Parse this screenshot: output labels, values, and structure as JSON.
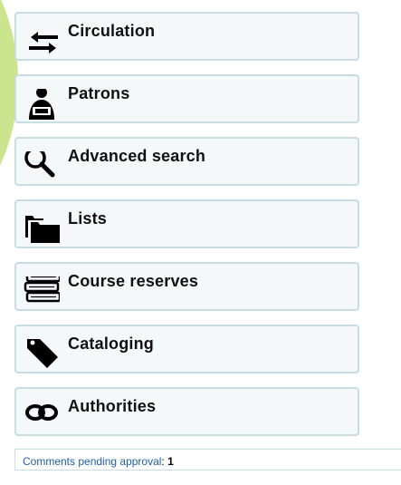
{
  "menu": {
    "items": [
      {
        "label": "Circulation",
        "icon": "circulation-arrows-icon"
      },
      {
        "label": "Patrons",
        "icon": "patron-reader-icon"
      },
      {
        "label": "Advanced search",
        "icon": "search-magnifier-icon"
      },
      {
        "label": "Lists",
        "icon": "folders-icon"
      },
      {
        "label": "Course reserves",
        "icon": "book-stack-icon"
      },
      {
        "label": "Cataloging",
        "icon": "tag-icon"
      },
      {
        "label": "Authorities",
        "icon": "chain-link-icon"
      }
    ]
  },
  "pending": {
    "label": "Comments pending approval",
    "separator": ":",
    "count": "1"
  },
  "colors": {
    "background_blob": "#cbe58f",
    "item_background": "#f4f8f9",
    "item_border": "#c7dde3",
    "link": "#1f5ea6"
  }
}
